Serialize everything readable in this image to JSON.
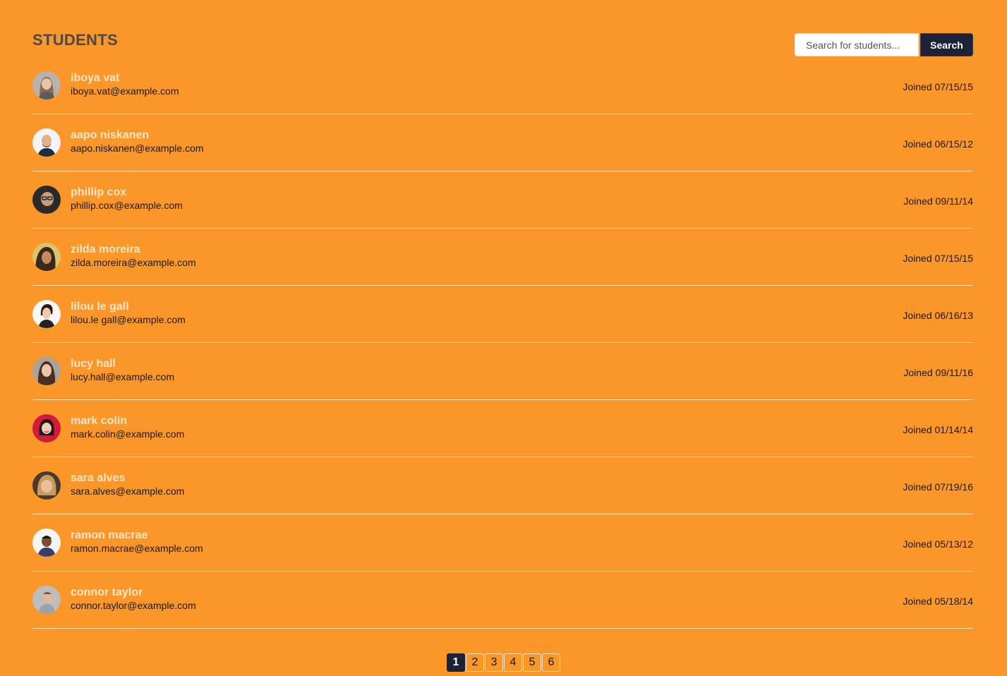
{
  "header": {
    "title": "STUDENTS"
  },
  "search": {
    "placeholder": "Search for students...",
    "button_label": "Search"
  },
  "students": [
    {
      "name": "iboya vat",
      "email": "iboya.vat@example.com",
      "joined": "Joined 07/15/15"
    },
    {
      "name": "aapo niskanen",
      "email": "aapo.niskanen@example.com",
      "joined": "Joined 06/15/12"
    },
    {
      "name": "phillip cox",
      "email": "phillip.cox@example.com",
      "joined": "Joined 09/11/14"
    },
    {
      "name": "zilda moreira",
      "email": "zilda.moreira@example.com",
      "joined": "Joined 07/15/15"
    },
    {
      "name": "lilou le gall",
      "email": "lilou.le gall@example.com",
      "joined": "Joined 06/16/13"
    },
    {
      "name": "lucy hall",
      "email": "lucy.hall@example.com",
      "joined": "Joined 09/11/16"
    },
    {
      "name": "mark colin",
      "email": "mark.colin@example.com",
      "joined": "Joined 01/14/14"
    },
    {
      "name": "sara alves",
      "email": "sara.alves@example.com",
      "joined": "Joined 07/19/16"
    },
    {
      "name": "ramon macrae",
      "email": "ramon.macrae@example.com",
      "joined": "Joined 05/13/12"
    },
    {
      "name": "connor taylor",
      "email": "connor.taylor@example.com",
      "joined": "Joined 05/18/14"
    }
  ],
  "pagination": {
    "pages": [
      "1",
      "2",
      "3",
      "4",
      "5",
      "6"
    ],
    "current": "1"
  },
  "colors": {
    "background": "#fb9628",
    "accent": "#1d2238",
    "name_text": "#fde6c9",
    "divider": "#fde0bf"
  }
}
